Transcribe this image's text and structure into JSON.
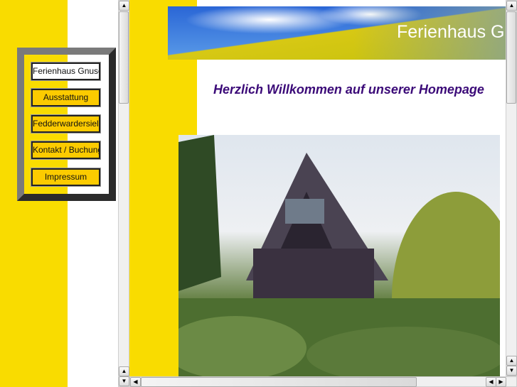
{
  "nav": {
    "items": [
      {
        "label": "Ferienhaus Gnuschke",
        "active": true
      },
      {
        "label": "Ausstattung"
      },
      {
        "label": "Fedderwardersiel und Umgebung"
      },
      {
        "label": "Kontakt / Buchung"
      },
      {
        "label": "Impressum"
      }
    ]
  },
  "banner": {
    "title": "Ferienhaus Gnuschke"
  },
  "main": {
    "welcome": "Herzlich Willkommen auf unserer Homepage"
  },
  "scroll": {
    "up": "▲",
    "down": "▼",
    "left": "◀",
    "right": "▶"
  },
  "colors": {
    "yellow": "#f9dc00",
    "button": "#fccb00",
    "heading": "#3b0a78"
  }
}
